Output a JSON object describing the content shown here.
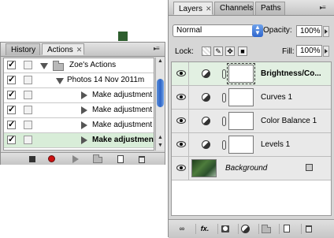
{
  "actions_panel": {
    "tabs": [
      {
        "label": "History",
        "active": false
      },
      {
        "label": "Actions",
        "active": true
      }
    ],
    "close_glyph": "✕",
    "menu_glyph": "▸≡",
    "rows": [
      {
        "checked": true,
        "expand": "down",
        "icon": "folder-icon",
        "label": "Zoe's Actions",
        "selected": false
      },
      {
        "checked": true,
        "expand": "down",
        "icon": "",
        "label": "Photos 14 Nov 2011m",
        "selected": false
      },
      {
        "checked": true,
        "expand": "right",
        "icon": "",
        "label": "Make adjustment l...",
        "selected": false
      },
      {
        "checked": true,
        "expand": "right",
        "icon": "",
        "label": "Make adjustment l...",
        "selected": false
      },
      {
        "checked": true,
        "expand": "right",
        "icon": "",
        "label": "Make adjustment l...",
        "selected": false
      },
      {
        "checked": true,
        "expand": "right",
        "icon": "",
        "label": "Make adjustment l...",
        "selected": true
      }
    ],
    "check_glyph": "✓",
    "footer_buttons": [
      "stop-icon",
      "record-icon",
      "play-icon",
      "new-set-icon",
      "new-action-icon",
      "trash-icon"
    ]
  },
  "layers_panel": {
    "tabs": [
      {
        "label": "Layers",
        "active": true
      },
      {
        "label": "Channels",
        "active": false
      },
      {
        "label": "Paths",
        "active": false
      }
    ],
    "close_glyph": "✕",
    "blend_mode": "Normal",
    "opacity_label": "Opacity:",
    "opacity_value": "100%",
    "lock_label": "Lock:",
    "fill_label": "Fill:",
    "fill_value": "100%",
    "layers": [
      {
        "name": "Brightness/Co...",
        "type": "adjustment",
        "selected": true
      },
      {
        "name": "Curves 1",
        "type": "adjustment",
        "selected": false
      },
      {
        "name": "Color Balance 1",
        "type": "adjustment",
        "selected": false
      },
      {
        "name": "Levels 1",
        "type": "adjustment",
        "selected": false
      },
      {
        "name": "Background",
        "type": "background",
        "selected": false
      }
    ],
    "footer_buttons": [
      "link-icon",
      "fx-icon",
      "mask-icon",
      "adjustment-icon",
      "group-icon",
      "new-layer-icon",
      "trash-icon"
    ],
    "fx_label": "fx."
  },
  "colors": {
    "selected_row": "#d8edd8",
    "record": "#cc1111",
    "scroll_thumb": "#2d64c8"
  }
}
